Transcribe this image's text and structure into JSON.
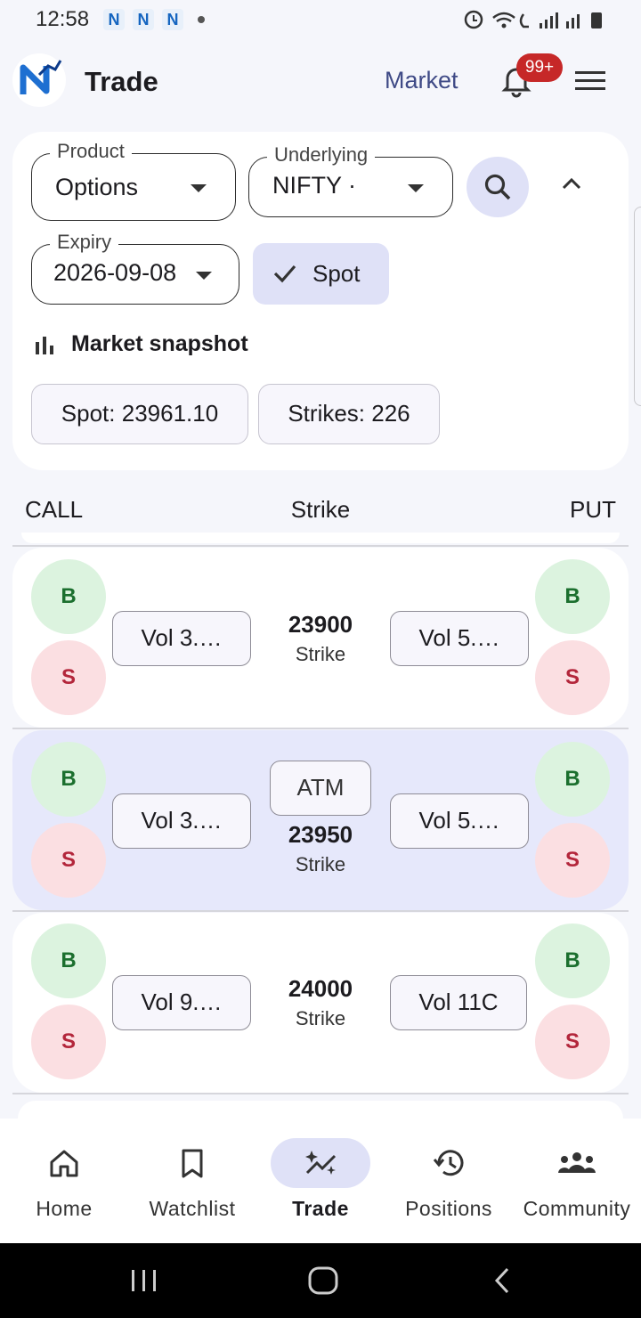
{
  "status_bar": {
    "time": "12:58",
    "notif_letter": "N"
  },
  "app_bar": {
    "title": "Trade",
    "market_link": "Market",
    "notif_badge": "99+"
  },
  "filters": {
    "product": {
      "label": "Product",
      "value": "Options"
    },
    "underlying": {
      "label": "Underlying",
      "value": "NIFTY ·"
    },
    "expiry": {
      "label": "Expiry",
      "value": "2026-09-08"
    },
    "spot_toggle": "Spot"
  },
  "snapshot": {
    "title": "Market snapshot",
    "spot": "Spot: 23961.10",
    "strikes": "Strikes: 226"
  },
  "table_header": {
    "call": "CALL",
    "strike": "Strike",
    "put": "PUT"
  },
  "rows": [
    {
      "strike": "23900",
      "strike_label": "Strike",
      "call_vol": "Vol 3.…",
      "put_vol": "Vol 5.…",
      "buy": "B",
      "sell": "S",
      "atm": false
    },
    {
      "strike": "23950",
      "strike_label": "Strike",
      "call_vol": "Vol 3.…",
      "put_vol": "Vol 5.…",
      "buy": "B",
      "sell": "S",
      "atm": true,
      "atm_label": "ATM"
    },
    {
      "strike": "24000",
      "strike_label": "Strike",
      "call_vol": "Vol 9.…",
      "put_vol": "Vol 11C",
      "buy": "B",
      "sell": "S",
      "atm": false
    }
  ],
  "bottom_nav": [
    {
      "label": "Home",
      "icon": "home-icon",
      "active": false
    },
    {
      "label": "Watchlist",
      "icon": "bookmark-icon",
      "active": false
    },
    {
      "label": "Trade",
      "icon": "sparkle-chart-icon",
      "active": true
    },
    {
      "label": "Positions",
      "icon": "history-icon",
      "active": false
    },
    {
      "label": "Community",
      "icon": "people-icon",
      "active": false
    }
  ],
  "colors": {
    "accent": "#3f4a86",
    "chip_bg": "#dfe1f7",
    "buy_bg": "#dcf3df",
    "buy_fg": "#1b6f2e",
    "sell_bg": "#fbdfe2",
    "sell_fg": "#b3263b",
    "badge": "#c62828"
  }
}
